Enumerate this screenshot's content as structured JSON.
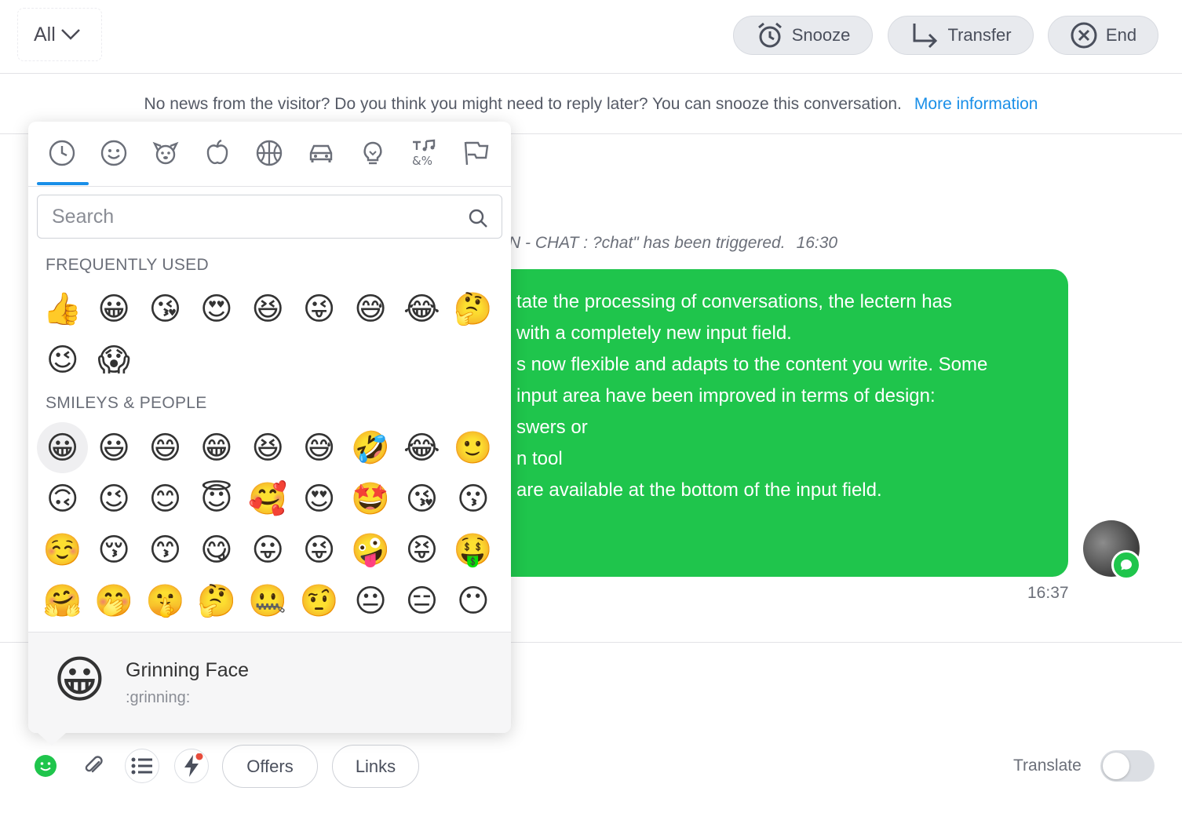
{
  "header": {
    "filter_label": "All",
    "buttons": [
      {
        "label": "Snooze",
        "icon": "alarm-clock-icon"
      },
      {
        "label": "Transfer",
        "icon": "transfer-arrow-icon"
      },
      {
        "label": "End",
        "icon": "close-circle-icon"
      }
    ]
  },
  "infobar": {
    "text": "No news from the visitor? Do you think you might need to reply later? You can snooze this conversation.",
    "link": "More information"
  },
  "conversation": {
    "system_message": "N - CHAT : ?chat\" has been triggered.",
    "system_time": "16:30",
    "message_lines": [
      "tate the processing of conversations, the lectern has",
      " with a completely new input field.",
      "s now flexible and adapts to the content you write. Some",
      " input area have been improved in terms of design:",
      "swers or",
      "n tool",
      " are available at the bottom of the input field."
    ],
    "message_time": "16:37",
    "bubble_color": "#1fc54c"
  },
  "emoji_picker": {
    "categories": [
      "recent-icon",
      "smiley-icon",
      "animal-icon",
      "food-icon",
      "sport-icon",
      "car-icon",
      "bulb-icon",
      "symbols-icon",
      "flag-icon"
    ],
    "active_category": 0,
    "search_placeholder": "Search",
    "sections": [
      {
        "title": "FREQUENTLY USED",
        "emojis": [
          "👍",
          "😀",
          "😘",
          "😍",
          "😆",
          "😜",
          "😅",
          "😂",
          "🤔",
          "😉",
          "😱"
        ]
      },
      {
        "title": "SMILEYS & PEOPLE",
        "emojis": [
          "😀",
          "😃",
          "😄",
          "😁",
          "😆",
          "😅",
          "🤣",
          "😂",
          "🙂",
          "🙃",
          "😉",
          "😊",
          "😇",
          "🥰",
          "😍",
          "🤩",
          "😘",
          "😗",
          "☺️",
          "😚",
          "😙",
          "😋",
          "😛",
          "😜",
          "🤪",
          "😝",
          "🤑",
          "🤗",
          "🤭",
          "🤫",
          "🤔",
          "🤐",
          "🤨",
          "😐",
          "😑",
          "😶"
        ]
      }
    ],
    "selected": {
      "emoji": "😀",
      "name": "Grinning Face",
      "code": ":grinning:"
    }
  },
  "toolbar": {
    "offers_label": "Offers",
    "links_label": "Links",
    "translate_label": "Translate",
    "translate_on": false,
    "accent": "#1fc54c",
    "notification_dot_color": "#e74c3c"
  }
}
